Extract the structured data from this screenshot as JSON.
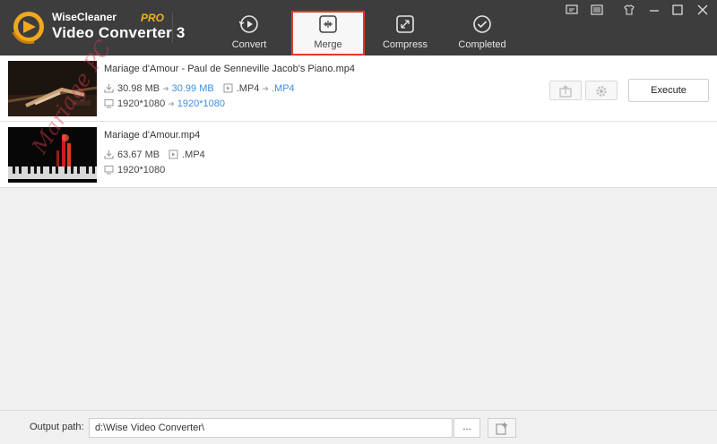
{
  "app": {
    "brand_line1": "WiseCleaner",
    "brand_line2": "Video Converter 3",
    "edition": "PRO"
  },
  "nav": {
    "tabs": [
      {
        "label": "Convert",
        "icon": "convert-icon",
        "active": false
      },
      {
        "label": "Merge",
        "icon": "merge-icon",
        "active": true
      },
      {
        "label": "Compress",
        "icon": "compress-icon",
        "active": false
      },
      {
        "label": "Completed",
        "icon": "completed-icon",
        "active": false
      }
    ]
  },
  "window_buttons": [
    "chat-icon",
    "menu-icon",
    "skin-icon",
    "minimize-icon",
    "maximize-icon",
    "close-icon"
  ],
  "files": [
    {
      "name": "Mariage d'Amour - Paul de Senneville Jacob's Piano.mp4",
      "size_from": "30.98 MB",
      "size_to": "30.99 MB",
      "format_from": ".MP4",
      "format_to": ".MP4",
      "res_from": "1920*1080",
      "res_to": "1920*1080"
    },
    {
      "name": "Mariage d'Amour.mp4",
      "size": "63.67 MB",
      "format": ".MP4",
      "res": "1920*1080"
    }
  ],
  "actions": {
    "execute_label": "Execute"
  },
  "watermark": "Mariage PC",
  "footer": {
    "output_label": "Output path:",
    "output_value": "d:\\Wise Video Converter\\",
    "browse_label": "..."
  },
  "colors": {
    "titlebar": "#3d3d3d",
    "accent_blue": "#3e8de0",
    "active_border": "#e0392b",
    "pro_gold": "#f2b01e"
  }
}
